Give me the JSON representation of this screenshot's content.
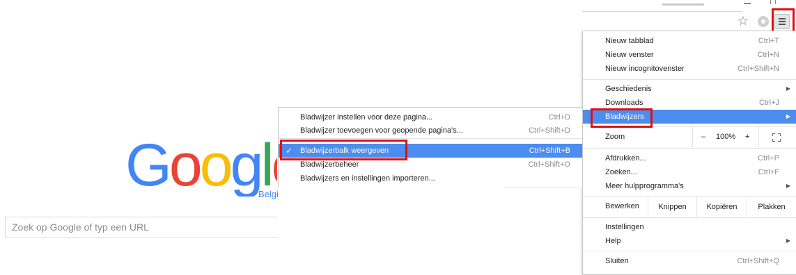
{
  "logo": {
    "letters": [
      "G",
      "o",
      "o",
      "g",
      "l",
      "e"
    ],
    "colors": [
      "#4285f4",
      "#ea4335",
      "#fbbc05",
      "#4285f4",
      "#34a853",
      "#ea4335"
    ],
    "sub": "Belgi"
  },
  "search": {
    "placeholder": "Zoek op Google of typ een URL"
  },
  "toolbar": {
    "star_icon": "☆",
    "extension_icon": "extension-icon",
    "menu_icon": "hamburger-menu-icon"
  },
  "menu": {
    "new_tab": {
      "label": "Nieuw tabblad",
      "shortcut": "Ctrl+T"
    },
    "new_window": {
      "label": "Nieuw venster",
      "shortcut": "Ctrl+N"
    },
    "new_incognito": {
      "label": "Nieuw incognitovenster",
      "shortcut": "Ctrl+Shift+N"
    },
    "history": {
      "label": "Geschiedenis"
    },
    "downloads": {
      "label": "Downloads",
      "shortcut": "Ctrl+J"
    },
    "bookmarks": {
      "label": "Bladwijzers"
    },
    "zoom": {
      "label": "Zoom",
      "minus": "–",
      "value": "100%",
      "plus": "+"
    },
    "print": {
      "label": "Afdrukken...",
      "shortcut": "Ctrl+P"
    },
    "find": {
      "label": "Zoeken...",
      "shortcut": "Ctrl+F"
    },
    "more_tools": {
      "label": "Meer hulpprogramma's"
    },
    "edit": {
      "label": "Bewerken",
      "cut": "Knippen",
      "copy": "Kopiëren",
      "paste": "Plakken"
    },
    "settings": {
      "label": "Instellingen"
    },
    "help": {
      "label": "Help"
    },
    "exit": {
      "label": "Sluiten",
      "shortcut": "Ctrl+Shift+Q"
    }
  },
  "submenu": {
    "bookmark_page": {
      "label": "Bladwijzer instellen voor deze pagina...",
      "shortcut": "Ctrl+D"
    },
    "bookmark_all": {
      "label": "Bladwijzer toevoegen voor geopende pagina's...",
      "shortcut": "Ctrl+Shift+D"
    },
    "show_bar": {
      "check": "✓",
      "label": "Bladwijzerbalk weergeven",
      "shortcut": "Ctrl+Shift+B"
    },
    "manager": {
      "label": "Bladwijzerbeheer",
      "shortcut": "Ctrl+Shift+O"
    },
    "import": {
      "label": "Bladwijzers en instellingen importeren..."
    }
  },
  "highlight_color": "#e01010"
}
